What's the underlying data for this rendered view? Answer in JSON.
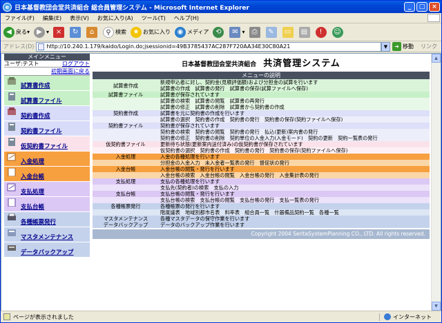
{
  "window": {
    "title": "日本基督教団会堂共済組合 総合員管理システム - Microsoft Internet Explorer"
  },
  "menubar": [
    "ファイル(F)",
    "編集(E)",
    "表示(V)",
    "お気に入り(A)",
    "ツール(T)",
    "ヘルプ(H)"
  ],
  "toolbar": {
    "back": "戻る",
    "search": "検索",
    "favorites": "お気に入り",
    "media": "メディア"
  },
  "address": {
    "label": "アドレス(D)",
    "url": "http://10.240.1.179/kaido/Login.do;jsessionid=49B3785437AC287F720AA34E30C80A21",
    "go": "移動",
    "links": "リンク"
  },
  "sidebar": {
    "header": "メインメニュー",
    "user": "ユーザ:テスト",
    "logout": "ログアウト",
    "home": "初期画面に戻る",
    "items": [
      {
        "label": "試算書作成",
        "color": "green"
      },
      {
        "label": "試算書ファイル",
        "color": "green"
      },
      {
        "label": "契約書作成",
        "color": "lav"
      },
      {
        "label": "契約書ファイル",
        "color": "lav"
      },
      {
        "label": "仮契約書ファイル",
        "color": "pink"
      },
      {
        "label": "入金処理",
        "color": "orange"
      },
      {
        "label": "入金台帳",
        "color": "orange"
      },
      {
        "label": "支払処理",
        "color": "purple"
      },
      {
        "label": "支払台帳",
        "color": "purple"
      },
      {
        "label": "各種帳票発行",
        "color": "blue"
      },
      {
        "label": "マスタメンテナンス",
        "color": "blue"
      },
      {
        "label": "データバックアップ",
        "color": "blue"
      }
    ]
  },
  "main": {
    "org": "日本基督教団会堂共済組合",
    "system": "共済管理システム",
    "section_title": "メニューの説明",
    "rows": [
      {
        "key": "試算書作成",
        "lines": [
          "新規申込者に対し、契約金(見積評価額)および分担金の試算を行います",
          "試算書の作成　試算書の発行　試算書の保存(試算ファイルへ保存)"
        ],
        "bg": "#d9f4d9"
      },
      {
        "key": "試算書ファイル",
        "lines": [
          "試算書が保存されています"
        ],
        "bg": "#c8f0c8"
      },
      {
        "key": "",
        "lines": [
          "試算書の検索　試算書の閲覧　試算書の再発行",
          "試算書の修正　試算書の削除　試算書から契約書の作成"
        ],
        "bg": "#e8f8e8"
      },
      {
        "key": "契約書作成",
        "lines": [
          "試算書を元に契約書の作成を行います"
        ],
        "bg": "#dde0f8"
      },
      {
        "key": "",
        "lines": [
          "試算書の選択　契約書の作成　契約書の発行　契約書の保存(契約ファイルへ保存)"
        ],
        "bg": "#eceefa"
      },
      {
        "key": "契約書ファイル",
        "lines": [
          "契約書が保存されています"
        ],
        "bg": "#dde0f8"
      },
      {
        "key": "",
        "lines": [
          "契約書の検索　契約書の閲覧　契約書の発行　払込(更新)案内書の発行",
          "契約書の修正　契約書の削除　契約単位の入金入力(入金モード)　契約の更新　契約一覧表の発行"
        ],
        "bg": "#eceefa"
      },
      {
        "key": "仮契約書ファイル",
        "lines": [
          "更新待ち状態(更新案内送付済み)の仮契約書が保存されています"
        ],
        "bg": "#fbe2ea"
      },
      {
        "key": "",
        "lines": [
          "仮契約書の選択　契約書の作成　契約書の発行　契約書の保存(契約ファイルへ保存)"
        ],
        "bg": "#fdf0f4"
      },
      {
        "key": "入金処理",
        "lines": [
          "入金の各種処理を行います"
        ],
        "bg": "#f7a040"
      },
      {
        "key": "",
        "lines": [
          "分担金の入金入力　未入金者一覧表の発行　督促状の発行"
        ],
        "bg": "#fbd7a8"
      },
      {
        "key": "入金台帳",
        "lines": [
          "入金台帳の閲覧・発行を行います"
        ],
        "bg": "#f7a040"
      },
      {
        "key": "",
        "lines": [
          "入金台帳の検索　入金台帳の閲覧　入金台帳の発行　入金集計表の発行"
        ],
        "bg": "#fbd7a8"
      },
      {
        "key": "支払処理",
        "lines": [
          "支払の各種処理を行います"
        ],
        "bg": "#dcc8f4"
      },
      {
        "key": "",
        "lines": [
          "支払先(契約者)の検索　支払の入力"
        ],
        "bg": "#ece2fa"
      },
      {
        "key": "支払台帳",
        "lines": [
          "支払台帳の閲覧・発行を行います"
        ],
        "bg": "#dcc8f4"
      },
      {
        "key": "",
        "lines": [
          "支払台帳の検索　支払台帳の閲覧　支払台帳の発行　支払一覧表の発行"
        ],
        "bg": "#ece2fa"
      },
      {
        "key": "各種帳票発行",
        "lines": [
          "各種帳票の発行を行います"
        ],
        "bg": "#c4d2ec"
      },
      {
        "key": "",
        "lines": [
          "階度議表　地域別都市名表　料率表　組合員一覧　什器備品契約一覧　各種一覧"
        ],
        "bg": "#dde6f4"
      },
      {
        "key": "マスタメンテナンス",
        "lines": [
          "各種マスタデータの保守作業を行います"
        ],
        "bg": "#c4d2ec"
      },
      {
        "key": "データバックアップ",
        "lines": [
          "データのバックアップ作業を行います"
        ],
        "bg": "#c4d2ec"
      }
    ],
    "copyright": "Copyright 2004 SeritaSystemPlanning CO., LTD. All rights reserved."
  },
  "status": {
    "text": "ページが表示されました",
    "zone": "インターネット"
  }
}
